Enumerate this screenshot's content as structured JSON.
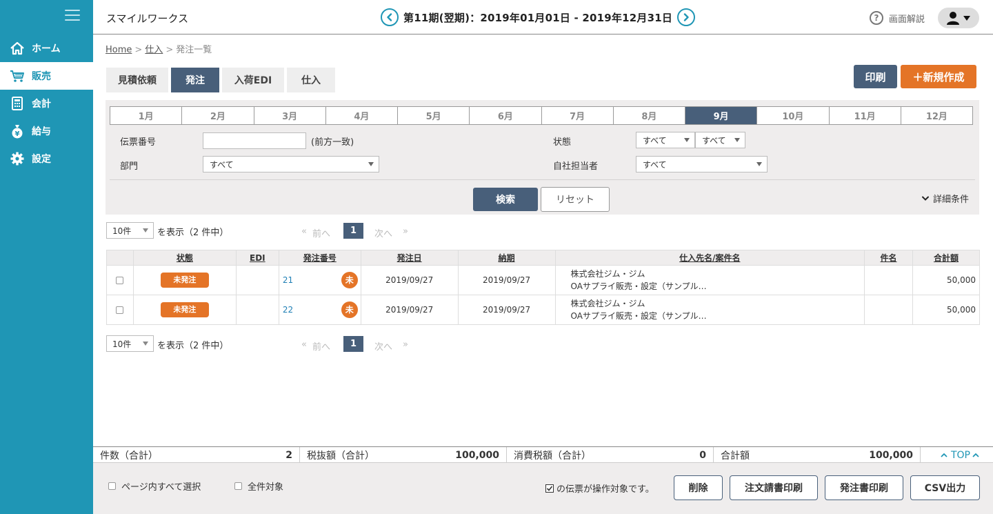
{
  "sidebar": {
    "items": [
      {
        "label": "ホーム",
        "icon": "home-icon"
      },
      {
        "label": "販売",
        "icon": "cart-icon"
      },
      {
        "label": "会計",
        "icon": "calculator-icon"
      },
      {
        "label": "給与",
        "icon": "money-bag-icon"
      },
      {
        "label": "設定",
        "icon": "gear-icon"
      }
    ],
    "active_index": 1
  },
  "header": {
    "company": "スマイルワークス",
    "period": "第11期(翌期)：2019年01月01日 - 2019年12月31日",
    "help_label": "画面解説"
  },
  "breadcrumb": {
    "home": "Home",
    "parent": "仕入",
    "current": "発注一覧",
    "separator": ">"
  },
  "tabs": [
    {
      "label": "見積依頼"
    },
    {
      "label": "発注",
      "active": true
    },
    {
      "label": "入荷EDI"
    },
    {
      "label": "仕入"
    }
  ],
  "actions": {
    "print": "印刷",
    "new": "＋新規作成"
  },
  "months": [
    "1月",
    "2月",
    "3月",
    "4月",
    "5月",
    "6月",
    "7月",
    "8月",
    "9月",
    "10月",
    "11月",
    "12月"
  ],
  "active_month_index": 8,
  "filters": {
    "slip_number_label": "伝票番号",
    "slip_number_value": "",
    "slip_number_hint": "(前方一致)",
    "department_label": "部門",
    "department_value": "すべて",
    "status_label": "状態",
    "status_value_1": "すべて",
    "status_value_2": "すべて",
    "staff_label": "自社担当者",
    "staff_value": "すべて",
    "search": "検索",
    "reset": "リセット",
    "detail": "詳細条件"
  },
  "pager": {
    "page_size": "10件",
    "show_text": "を表示（2 件中）",
    "first": "«",
    "prev": "前へ",
    "current": "1",
    "next": "次へ",
    "last": "»"
  },
  "table": {
    "headers": {
      "status": "状態",
      "edi": "EDI",
      "order_no": "発注番号",
      "order_date": "発注日",
      "due_date": "納期",
      "supplier": "仕入先名/案件名",
      "subject": "件名",
      "total": "合計額"
    },
    "rows": [
      {
        "status": "未発注",
        "edi": "",
        "order_no": "21",
        "mark": "未",
        "order_date": "2019/09/27",
        "due_date": "2019/09/27",
        "supplier": "株式会社ジム・ジム",
        "project": "OAサプライ販売・設定（サンプル…",
        "subject": "",
        "total": "50,000"
      },
      {
        "status": "未発注",
        "edi": "",
        "order_no": "22",
        "mark": "未",
        "order_date": "2019/09/27",
        "due_date": "2019/09/27",
        "supplier": "株式会社ジム・ジム",
        "project": "OAサプライ販売・設定（サンプル…",
        "subject": "",
        "total": "50,000"
      }
    ]
  },
  "summary": {
    "count_label": "件数（合計）",
    "count_value": "2",
    "pretax_label": "税抜額（合計）",
    "pretax_value": "100,000",
    "tax_label": "消費税額（合計）",
    "tax_value": "0",
    "total_label": "合計額",
    "total_value": "100,000",
    "top": "TOP"
  },
  "footer": {
    "select_page": "ページ内すべて選択",
    "select_all": "全件対象",
    "target_note": "の伝票が操作対象です。",
    "delete": "削除",
    "order_request_print": "注文請書印刷",
    "order_print": "発注書印刷",
    "csv": "CSV出力"
  },
  "colors": {
    "sidebar": "#1f96b5",
    "navy": "#485f7a",
    "accent": "#e47427"
  }
}
